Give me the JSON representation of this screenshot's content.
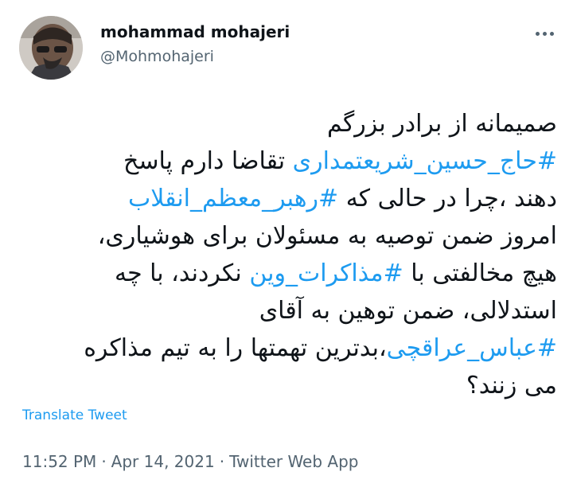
{
  "author": {
    "display_name": "mohammad mohajeri",
    "handle": "@Mohmohajeri"
  },
  "tweet": {
    "lines": [
      [
        {
          "text": "صمیمانه از برادر بزرگم"
        }
      ],
      [
        {
          "text": "#حاج_حسین_شریعتمداری",
          "hashtag": true
        },
        {
          "text": " تقاضا دارم پاسخ"
        }
      ],
      [
        {
          "text": "دهند ،چرا در حالی که "
        },
        {
          "text": "#رهبر_معظم_انقلاب",
          "hashtag": true
        }
      ],
      [
        {
          "text": "امروز ضمن توصیه به مسئولان برای هوشیاری،"
        }
      ],
      [
        {
          "text": "هیچ مخالفتی با "
        },
        {
          "text": "#مذاکرات_وین",
          "hashtag": true
        },
        {
          "text": " نکردند، با چه"
        }
      ],
      [
        {
          "text": "استدلالی، ضمن توهین به آقای"
        }
      ],
      [
        {
          "text": "#عباس_عراقچی",
          "hashtag": true
        },
        {
          "text": "،بدترین تهمتها را به تیم مذاکره"
        }
      ],
      [
        {
          "text": "می زنند؟"
        }
      ]
    ]
  },
  "translate_label": "Translate Tweet",
  "meta": {
    "time": "11:52 PM",
    "separator": "·",
    "date": "Apr 14, 2021",
    "source": "Twitter Web App"
  },
  "icons": {
    "more": "more-horizontal-icon",
    "avatar": "profile-photo"
  },
  "colors": {
    "link": "#1d9bf0",
    "text": "#0f1419",
    "secondary": "#536471"
  }
}
